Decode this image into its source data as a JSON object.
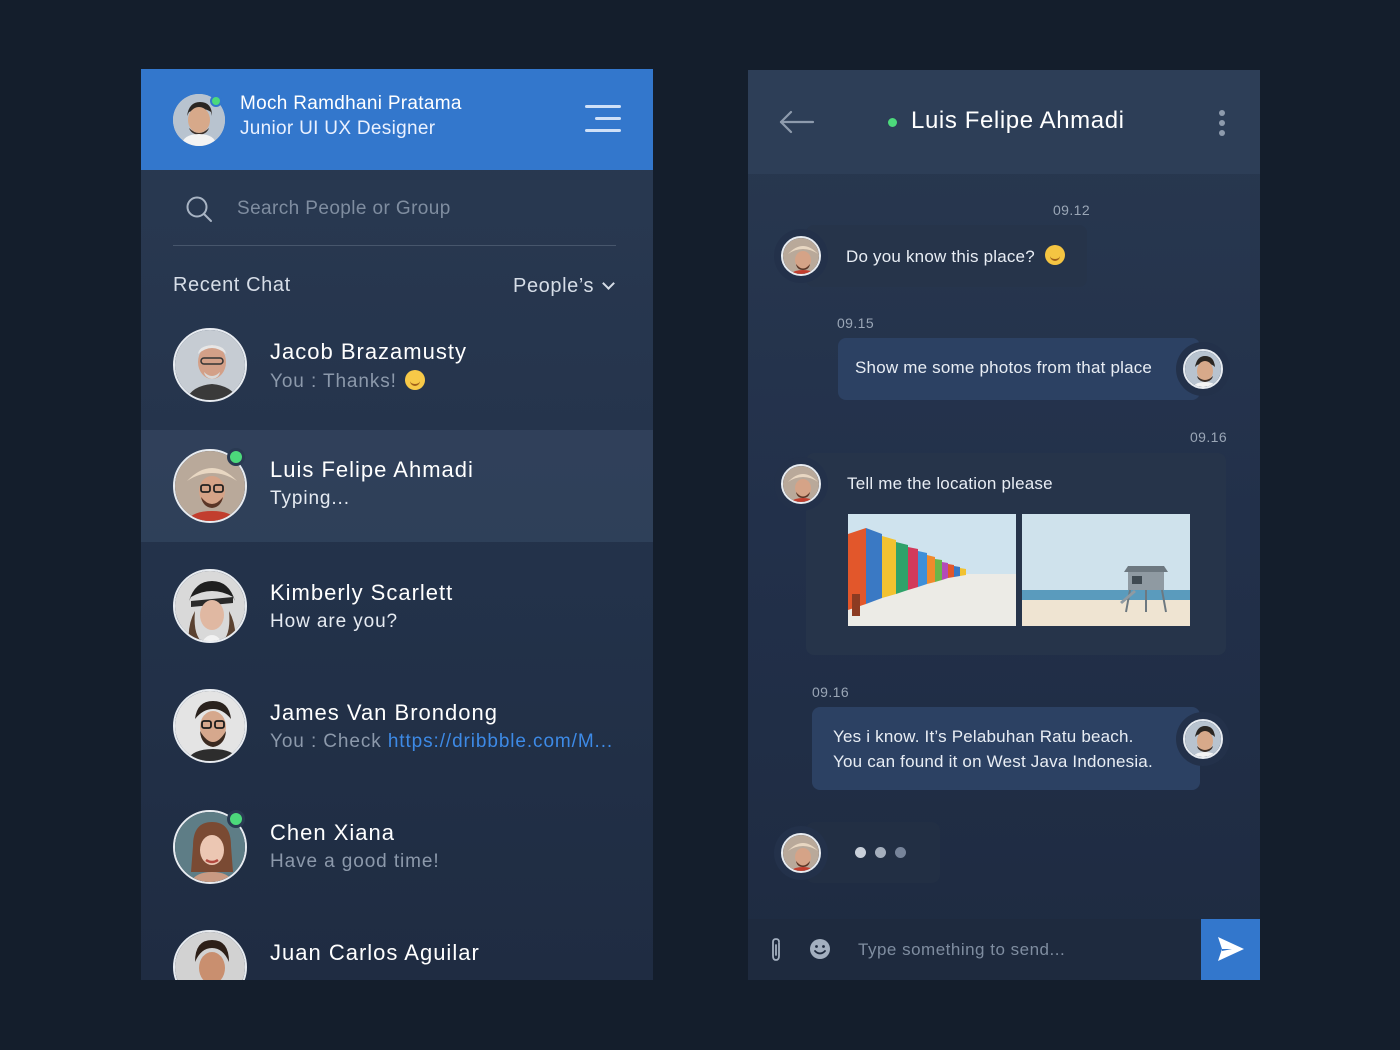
{
  "colors": {
    "background": "#141e2c",
    "accent": "#3377cc",
    "online": "#4cd97b",
    "link": "#3d8ae6"
  },
  "profile": {
    "name": "Moch Ramdhani Pratama",
    "role": "Junior UI UX Designer",
    "online": true
  },
  "search": {
    "placeholder": "Search People or Group"
  },
  "recent": {
    "title": "Recent Chat",
    "filter_label": "People’s"
  },
  "chats": [
    {
      "name": "Jacob Brazamusty",
      "preview": "You : Thanks!",
      "emoji": "smile-emoji",
      "online": false,
      "active": false
    },
    {
      "name": "Luis Felipe Ahmadi",
      "preview": "Typing...",
      "online": true,
      "active": true
    },
    {
      "name": "Kimberly Scarlett",
      "preview": "How are you?",
      "online": false,
      "active": false
    },
    {
      "name": "James Van Brondong",
      "preview_prefix": "You : Check ",
      "preview_link": "https://dribbble.com/M...",
      "online": false,
      "active": false
    },
    {
      "name": "Chen Xiana",
      "preview": "Have a good time!",
      "online": true,
      "active": false
    },
    {
      "name": "Juan Carlos Aguilar",
      "preview": "",
      "online": false,
      "active": false
    }
  ],
  "conversation": {
    "contact_name": "Luis Felipe Ahmadi",
    "contact_online": true,
    "messages": [
      {
        "time": "09.12",
        "direction": "incoming",
        "text": "Do you know this place?",
        "emoji": "grin-emoji"
      },
      {
        "time": "09.15",
        "direction": "outgoing",
        "text": "Show me some photos from that place"
      },
      {
        "time": "09.16",
        "direction": "incoming",
        "text": "Tell me the location please",
        "photos": [
          "beach-huts-photo",
          "lifeguard-tower-photo"
        ]
      },
      {
        "time": "09.16",
        "direction": "outgoing",
        "lines": [
          "Yes i know. It’s Pelabuhan Ratu beach.",
          "You can found it on West Java Indonesia."
        ]
      }
    ],
    "typing_indicator": true
  },
  "composer": {
    "placeholder": "Type something to send..."
  }
}
